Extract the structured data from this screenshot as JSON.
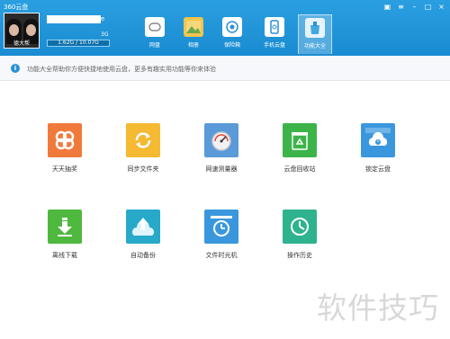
{
  "app": {
    "title": "360云盘"
  },
  "window_controls": [
    "skin-icon",
    "menu-icon",
    "minimize-icon",
    "maximize-icon",
    "close-icon"
  ],
  "user": {
    "avatar_caption": "德大帮",
    "name_suffix": "e",
    "level": "3G",
    "quota": "1.62G / 10.07G"
  },
  "tabs": [
    {
      "label": "网盘",
      "icon": "cloud-icon",
      "active": false
    },
    {
      "label": "相册",
      "icon": "photo-icon",
      "active": false
    },
    {
      "label": "保险箱",
      "icon": "safe-icon",
      "active": false
    },
    {
      "label": "手机云盘",
      "icon": "phone-cloud-icon",
      "active": false
    },
    {
      "label": "功能大全",
      "icon": "toolbox-icon",
      "active": true
    }
  ],
  "info": {
    "text": "功能大全帮助你方便快捷地使用云盘，更多有趣实用功能等你来体验"
  },
  "features": [
    {
      "label": "天天抽奖",
      "icon": "gift-icon",
      "color": "#f07a3c"
    },
    {
      "label": "同步文件夹",
      "icon": "sync-folder-icon",
      "color": "#f5b932"
    },
    {
      "label": "网速测量器",
      "icon": "speedometer-icon",
      "color": "#5a9ad8"
    },
    {
      "label": "云盘回收站",
      "icon": "recycle-bin-icon",
      "color": "#3db44a"
    },
    {
      "label": "锁定云盘",
      "icon": "lock-cloud-icon",
      "color": "#3a97de"
    },
    {
      "label": "离线下载",
      "icon": "offline-download-icon",
      "color": "#4fb83e"
    },
    {
      "label": "自动备份",
      "icon": "auto-backup-icon",
      "color": "#27a9c9"
    },
    {
      "label": "文件时光机",
      "icon": "time-machine-icon",
      "color": "#3a97de"
    },
    {
      "label": "操作历史",
      "icon": "history-icon",
      "color": "#2fb28e"
    }
  ],
  "watermark": "软件技巧"
}
